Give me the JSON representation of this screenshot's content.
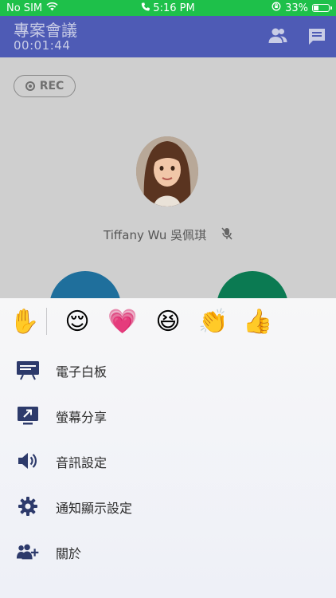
{
  "status_bar": {
    "carrier": "No SIM",
    "time": "5:16 PM",
    "battery": "33%",
    "battery_level": 0.33
  },
  "header": {
    "title": "專案會議",
    "timer": "00:01:44"
  },
  "call": {
    "rec_label": "REC",
    "participant_name": "Tiffany Wu 吳佩琪"
  },
  "reactions": [
    {
      "name": "raise-hand",
      "glyph": "✋"
    },
    {
      "name": "relieved-face",
      "glyph": "😌"
    },
    {
      "name": "heart",
      "glyph": "💗"
    },
    {
      "name": "laughing-face",
      "glyph": "😆"
    },
    {
      "name": "clapping-hands",
      "glyph": "👏"
    },
    {
      "name": "thumbs-up",
      "glyph": "👍"
    }
  ],
  "menu": {
    "items": [
      {
        "label": "電子白板",
        "icon": "whiteboard-icon"
      },
      {
        "label": "螢幕分享",
        "icon": "screen-share-icon"
      },
      {
        "label": "音訊設定",
        "icon": "speaker-icon"
      },
      {
        "label": "通知顯示設定",
        "icon": "gear-icon"
      },
      {
        "label": "關於",
        "icon": "people-icon"
      }
    ]
  },
  "colors": {
    "status_green": "#1ec04a",
    "header_blue": "#4e5bb5",
    "icon_navy": "#2d3a6b"
  }
}
